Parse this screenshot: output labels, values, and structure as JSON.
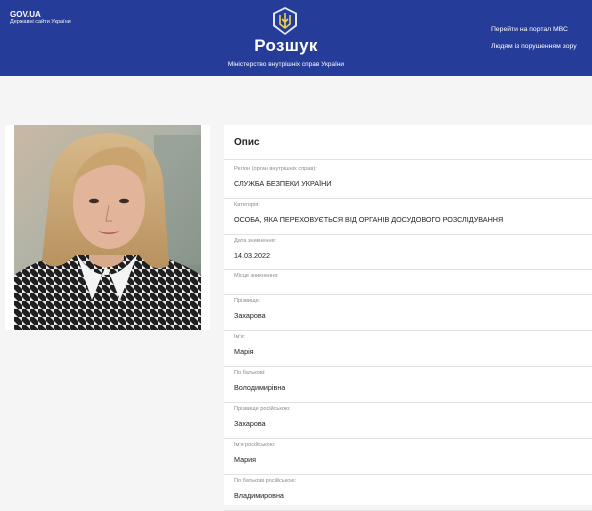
{
  "header": {
    "gov_logo": {
      "name": "GOV.UA",
      "subtitle": "Державні сайти України"
    },
    "title": "Розшук",
    "subtitle": "Міністерство внутрішніх справ України",
    "links": [
      {
        "label": "Перейти на портал МВС"
      },
      {
        "label": "Людям із порушенням зору"
      }
    ],
    "emblem_icon": "trident-icon"
  },
  "colors": {
    "header_bg": "#263c99",
    "page_bg": "#f5f5f5",
    "card_bg": "#ffffff",
    "label": "#8a8a8a"
  },
  "description": {
    "title": "Опис",
    "fields": [
      {
        "label": "Регіон (орган внутрішніх справ):",
        "value": "СЛУЖБА БЕЗПЕКИ УКРАЇНИ"
      },
      {
        "label": "Категорія:",
        "value": "ОСОБА, ЯКА ПЕРЕХОВУЄТЬСЯ ВІД ОРГАНІВ ДОСУДОВОГО РОЗСЛІДУВАННЯ"
      },
      {
        "label": "Дата зникнення:",
        "value": "14.03.2022"
      },
      {
        "label": "Місце зникнення:",
        "value": ""
      },
      {
        "label": "Прізвище:",
        "value": "Захарова"
      },
      {
        "label": "Ім'я:",
        "value": "Марія"
      },
      {
        "label": "По батькові:",
        "value": "Володимирівна"
      },
      {
        "label": "Прізвище російською:",
        "value": "Захарова"
      },
      {
        "label": "Ім'я російською:",
        "value": "Мария"
      },
      {
        "label": "По батькові російською:",
        "value": "Владимировна"
      }
    ]
  }
}
